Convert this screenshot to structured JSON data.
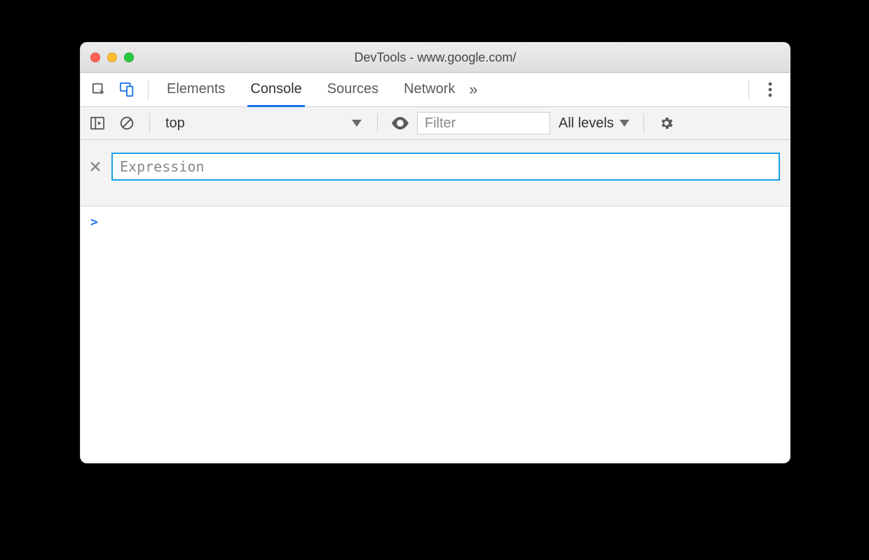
{
  "window": {
    "title": "DevTools - www.google.com/"
  },
  "tabs": {
    "items": [
      "Elements",
      "Console",
      "Sources",
      "Network"
    ],
    "active": "Console",
    "overflow_glyph": "»"
  },
  "console_toolbar": {
    "context": "top",
    "filter_placeholder": "Filter",
    "levels_label": "All levels"
  },
  "live_expression": {
    "placeholder": "Expression",
    "value": ""
  },
  "prompt": {
    "caret": ">"
  },
  "colors": {
    "accent_blue": "#1a73e8",
    "focus_cyan": "#19a0e8"
  }
}
